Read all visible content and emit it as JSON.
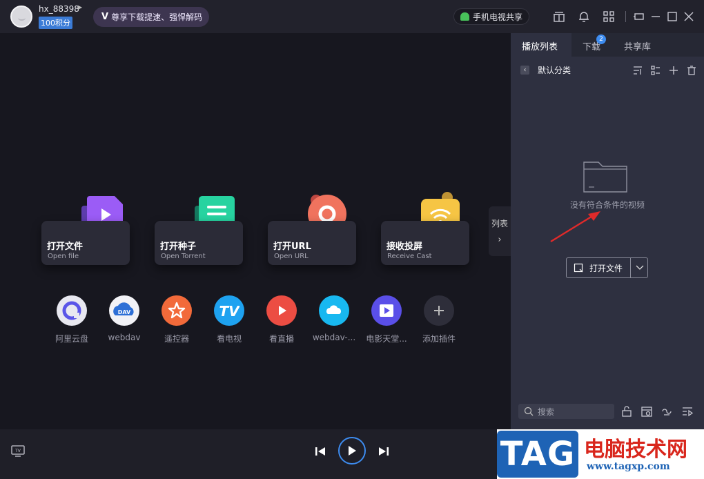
{
  "user": {
    "name": "hx_88398",
    "points": "100积分"
  },
  "vip_banner": {
    "icon": "V",
    "text": "尊享下载提速、强悍解码"
  },
  "phone_share": {
    "label": "手机电视共享"
  },
  "cards": [
    {
      "title": "打开文件",
      "subtitle": "Open file"
    },
    {
      "title": "打开种子",
      "subtitle": "Open Torrent"
    },
    {
      "title": "打开URL",
      "subtitle": "Open URL"
    },
    {
      "title": "接收投屏",
      "subtitle": "Receive Cast"
    }
  ],
  "plugins": [
    {
      "label": "阿里云盘",
      "icon": "aliyun-drive-icon"
    },
    {
      "label": "webdav",
      "icon": "webdav-icon"
    },
    {
      "label": "遥控器",
      "icon": "remote-control-icon"
    },
    {
      "label": "看电视",
      "icon": "tv-icon"
    },
    {
      "label": "看直播",
      "icon": "live-icon"
    },
    {
      "label": "webdav-...",
      "icon": "webdav-plugin-icon"
    },
    {
      "label": "电影天堂...",
      "icon": "movie-heaven-icon"
    },
    {
      "label": "添加插件",
      "icon": "add-plugin-icon"
    }
  ],
  "list_toggle": {
    "label": "列表"
  },
  "panel": {
    "tabs": [
      {
        "label": "播放列表"
      },
      {
        "label": "下载"
      },
      {
        "label": "共享库"
      }
    ],
    "download_badge": "2",
    "category": "默认分类",
    "empty_text": "没有符合条件的视频",
    "open_button": "打开文件",
    "search_placeholder": "搜索"
  },
  "watermark": {
    "tag": "TAG",
    "title": "电脑技术网",
    "url": "www.tagxp.com"
  },
  "colors": {
    "accent": "#3d8cf0",
    "background": "#17171f",
    "panel": "#2e3040"
  }
}
